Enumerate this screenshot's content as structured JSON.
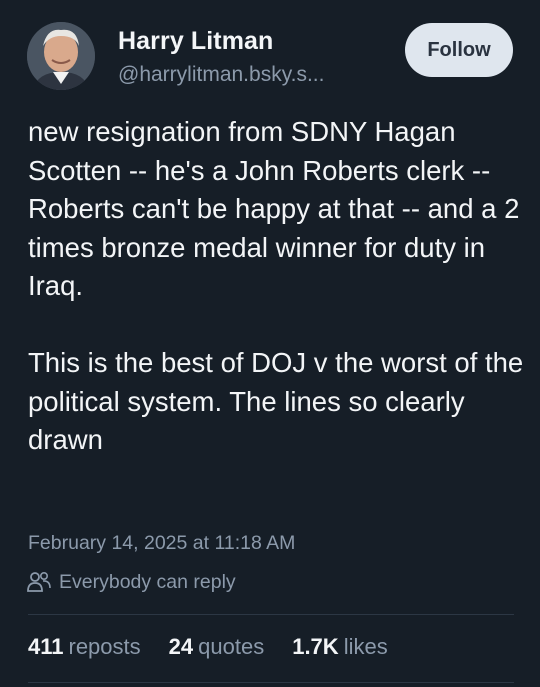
{
  "author": {
    "name": "Harry Litman",
    "handle": "@harrylitman.bsky.s..."
  },
  "follow_label": "Follow",
  "post": {
    "paragraph1": "new resignation from SDNY Hagan Scotten -- he's a John Roberts clerk -- Roberts can't be happy at that -- and a 2 times bronze medal winner for duty in Iraq.",
    "paragraph2": "This is the best of DOJ v the worst of the political system.  The lines so clearly drawn"
  },
  "timestamp": "February 14, 2025 at 11:18 AM",
  "reply_setting": {
    "icon": "people-icon",
    "label": "Everybody can reply"
  },
  "stats": {
    "reposts": {
      "count": "411",
      "label": "reposts"
    },
    "quotes": {
      "count": "24",
      "label": "quotes"
    },
    "likes": {
      "count": "1.7K",
      "label": "likes"
    }
  },
  "colors": {
    "background": "#161e27",
    "text": "#f3f5f7",
    "muted": "#8c9aab",
    "follow_button_bg": "#dfe6ee"
  }
}
